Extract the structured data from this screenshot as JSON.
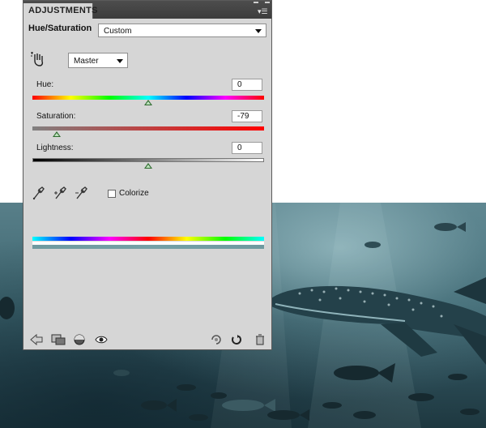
{
  "panel": {
    "tab_label": "ADJUSTMENTS",
    "title": "Hue/Saturation",
    "preset_value": "Custom",
    "channel_value": "Master"
  },
  "sliders": {
    "hue": {
      "label": "Hue:",
      "value": "0",
      "level": 0.5
    },
    "saturation": {
      "label": "Saturation:",
      "value": "-79",
      "level": 0.105
    },
    "lightness": {
      "label": "Lightness:",
      "value": "0",
      "level": 0.5
    }
  },
  "colorize": {
    "label": "Colorize",
    "checked": false
  },
  "icons": {
    "hand": "targeted-adjustment-hand-icon",
    "eyedroppers": [
      "eyedropper-icon",
      "eyedropper-plus-icon",
      "eyedropper-minus-icon"
    ],
    "bottom_left": [
      "back-arrow-icon",
      "clip-to-layer-icon",
      "visibility-toggle-icon",
      "eye-icon"
    ],
    "bottom_right": [
      "view-previous-state-icon",
      "reset-icon",
      "trash-icon"
    ]
  },
  "colors": {
    "panel_bg": "#d6d6d6",
    "thumb": "#2f6b2f",
    "water": "#3e6670"
  }
}
